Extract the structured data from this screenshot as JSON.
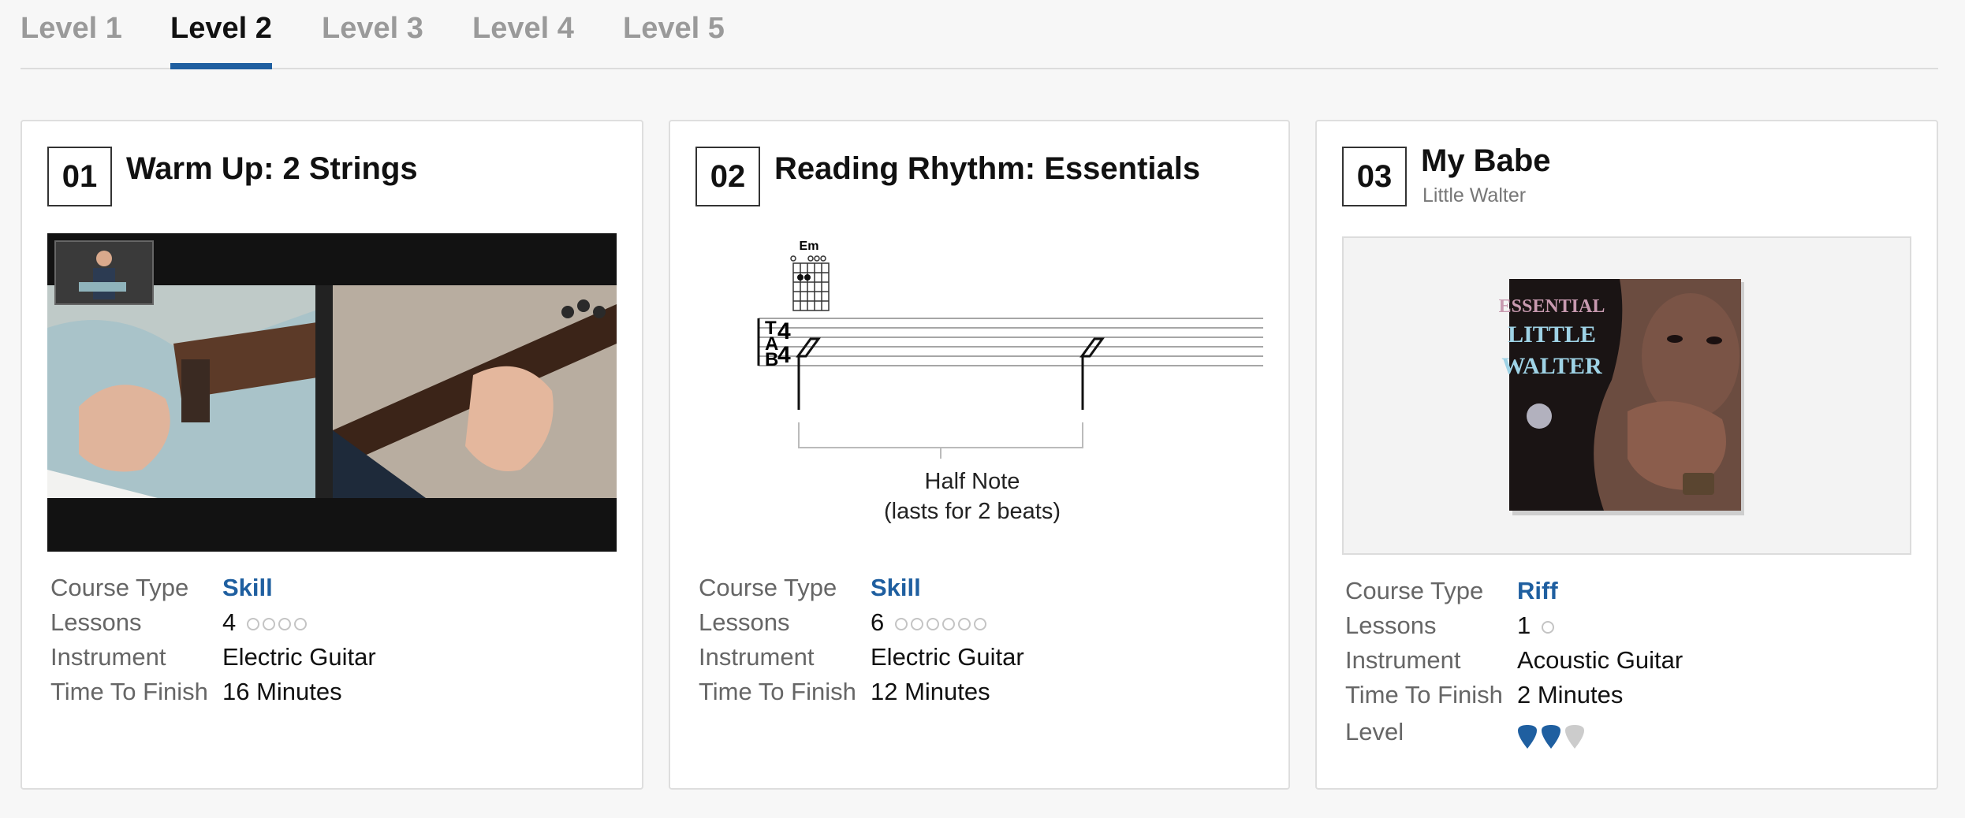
{
  "tabs": [
    {
      "label": "Level 1",
      "active": false
    },
    {
      "label": "Level 2",
      "active": true
    },
    {
      "label": "Level 3",
      "active": false
    },
    {
      "label": "Level 4",
      "active": false
    },
    {
      "label": "Level 5",
      "active": false
    }
  ],
  "labels": {
    "course_type": "Course Type",
    "lessons": "Lessons",
    "instrument": "Instrument",
    "time_to_finish": "Time To Finish",
    "level": "Level"
  },
  "cards": [
    {
      "number": "01",
      "title": "Warm Up: 2 Strings",
      "course_type": "Skill",
      "lessons": "4",
      "lesson_count": 4,
      "instrument": "Electric Guitar",
      "time_to_finish": "16 Minutes"
    },
    {
      "number": "02",
      "title": "Reading Rhythm: Essentials",
      "notation": {
        "chord": "Em",
        "tab_letters": [
          "T",
          "A",
          "B"
        ],
        "time_signature": [
          "4",
          "4"
        ],
        "caption_line1": "Half Note",
        "caption_line2": "(lasts for 2 beats)"
      },
      "course_type": "Skill",
      "lessons": "6",
      "lesson_count": 6,
      "instrument": "Electric Guitar",
      "time_to_finish": "12 Minutes"
    },
    {
      "number": "03",
      "title": "My Babe",
      "artist": "Little Walter",
      "album_art": {
        "line1": "ESSENTIAL",
        "line2": "LITTLE",
        "line3": "WALTER"
      },
      "course_type": "Riff",
      "lessons": "1",
      "lesson_count": 1,
      "instrument": "Acoustic Guitar",
      "time_to_finish": "2 Minutes",
      "level_rating": 2,
      "level_max": 3
    }
  ],
  "colors": {
    "accent": "#1f5fa0",
    "inactive_tab": "#9a9a9a",
    "pick_off": "#cccccc"
  },
  "icons": {
    "lesson_dot": "circle-outline-icon",
    "level_pick": "guitar-pick-icon"
  }
}
